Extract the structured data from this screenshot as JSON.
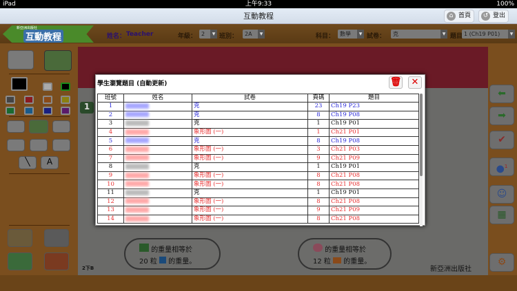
{
  "status": {
    "device": "iPad",
    "time": "上午9:33",
    "battery": "100%"
  },
  "nav": {
    "title": "互動教程",
    "home": "首頁",
    "logout": "登出"
  },
  "header": {
    "logo_sub": "新亞洲出版社",
    "logo": "互動教程",
    "name_label": "姓名：",
    "name": "Teacher",
    "grade_label": "年級：",
    "grade": "2",
    "class_label": "班別：",
    "class": "2A",
    "subject_label": "科目：",
    "subject": "數學",
    "paper_label": "試卷：",
    "paper": "克",
    "question_label": "題目：",
    "question": "1 (Ch19 P01)"
  },
  "toolbar": {
    "text_tool": "A"
  },
  "page": {
    "badge": "1",
    "page_label": "2下B",
    "publisher": "新亞洲出版社",
    "bubble1_l1": "的重量相等於",
    "bubble1_l2a": "20 粒",
    "bubble1_l2b": "的重量。",
    "bubble2_l1": "的重量相等於",
    "bubble2_l2a": "12 粒",
    "bubble2_l2b": "的重量。"
  },
  "right": {
    "globe_badge": "1"
  },
  "modal": {
    "title": "學生瀏覽題目 (自動更新)",
    "headers": [
      "班號",
      "姓名",
      "試卷",
      "頁碼",
      "題目"
    ],
    "rows": [
      {
        "no": "1",
        "paper": "克",
        "page": "23",
        "q": "Ch19 P23",
        "color": "blue"
      },
      {
        "no": "2",
        "paper": "克",
        "page": "8",
        "q": "Ch19 P08",
        "color": "blue"
      },
      {
        "no": "3",
        "paper": "克",
        "page": "1",
        "q": "Ch19 P01",
        "color": "black"
      },
      {
        "no": "4",
        "paper": "象形圖 (一)",
        "page": "1",
        "q": "Ch21 P01",
        "color": "red"
      },
      {
        "no": "5",
        "paper": "克",
        "page": "8",
        "q": "Ch19 P08",
        "color": "blue"
      },
      {
        "no": "6",
        "paper": "象形圖 (一)",
        "page": "3",
        "q": "Ch21 P03",
        "color": "red"
      },
      {
        "no": "7",
        "paper": "象形圖 (一)",
        "page": "9",
        "q": "Ch21 P09",
        "color": "red"
      },
      {
        "no": "8",
        "paper": "克",
        "page": "1",
        "q": "Ch19 P01",
        "color": "black"
      },
      {
        "no": "9",
        "paper": "象形圖 (一)",
        "page": "8",
        "q": "Ch21 P08",
        "color": "red"
      },
      {
        "no": "10",
        "paper": "象形圖 (一)",
        "page": "8",
        "q": "Ch21 P08",
        "color": "red"
      },
      {
        "no": "11",
        "paper": "克",
        "page": "1",
        "q": "Ch19 P01",
        "color": "black"
      },
      {
        "no": "12",
        "paper": "象形圖 (一)",
        "page": "8",
        "q": "Ch21 P08",
        "color": "red"
      },
      {
        "no": "13",
        "paper": "象形圖 (一)",
        "page": "9",
        "q": "Ch21 P09",
        "color": "red"
      },
      {
        "no": "14",
        "paper": "象形圖 (一)",
        "page": "8",
        "q": "Ch21 P08",
        "color": "red"
      }
    ]
  },
  "colors": {
    "blue": "#2a2ad8",
    "red": "#e83030",
    "black": "#111111"
  }
}
